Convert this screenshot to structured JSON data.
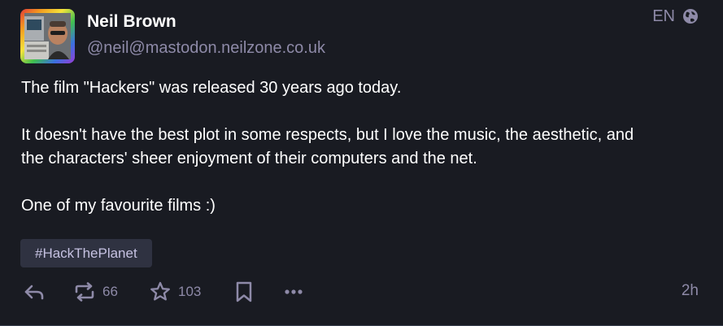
{
  "author": {
    "display_name": "Neil Brown",
    "handle": "@neil@mastodon.neilzone.co.uk"
  },
  "language": "EN",
  "post": {
    "paragraphs": [
      "The film \"Hackers\" was released 30 years ago today.",
      "It doesn't have the best plot in some respects, but I love the music, the aesthetic, and",
      "the characters' sheer enjoyment of their computers and the net.",
      "One of my favourite films :)"
    ],
    "hashtag": "#HackThePlanet"
  },
  "actions": {
    "boost_count": "66",
    "favourite_count": "103"
  },
  "timestamp": "2h",
  "icons": {
    "globe": "globe-icon",
    "reply": "reply-icon",
    "boost": "boost-icon",
    "favourite": "star-icon",
    "bookmark": "bookmark-icon",
    "more": "more-icon"
  },
  "colors": {
    "background": "#191b22",
    "text": "#ffffff",
    "muted": "#8e8aa8",
    "hashtag_bg": "#2f3241",
    "hashtag_text": "#c6c2e2"
  }
}
